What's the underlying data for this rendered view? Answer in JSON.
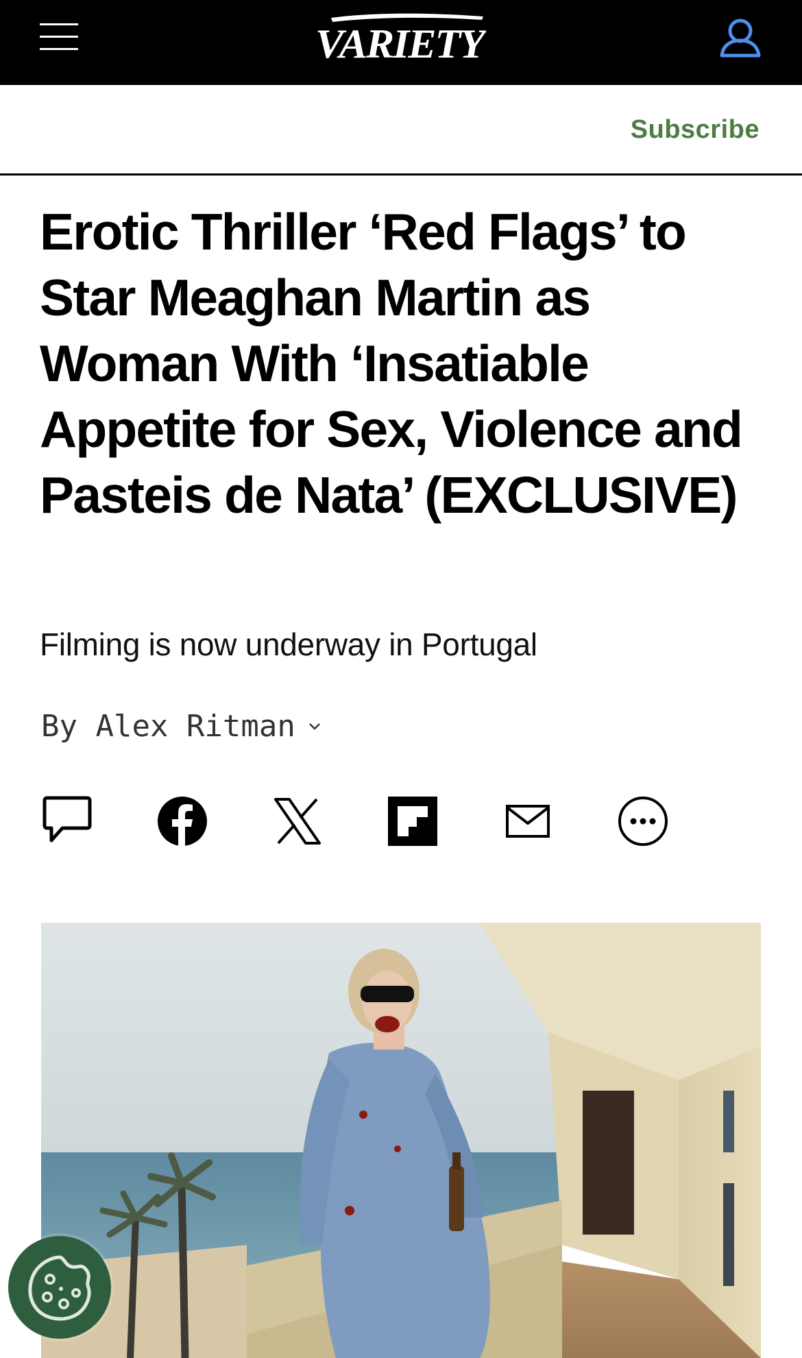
{
  "header": {
    "logo_text": "VARIETY",
    "menu_icon": "hamburger-menu-icon",
    "account_icon": "user-account-icon",
    "accent_color": "#3b82f6"
  },
  "subheader": {
    "subscribe_label": "Subscribe",
    "subscribe_color": "#4d7c43"
  },
  "article": {
    "headline": "Erotic Thriller ‘Red Flags’ to Star Meaghan Martin as Woman With ‘Insatiable Appetite for Sex, Violence and Pasteis de Nata’ (EXCLUSIVE)",
    "dek": "Filming is now underway in Portugal",
    "byline": "By Alex Ritman"
  },
  "share": [
    {
      "icon": "comment-icon"
    },
    {
      "icon": "facebook-icon"
    },
    {
      "icon": "x-icon"
    },
    {
      "icon": "flipboard-icon"
    },
    {
      "icon": "email-icon"
    },
    {
      "icon": "more-options-icon"
    }
  ],
  "cookie_button": {
    "icon": "cookie-icon",
    "color": "#2f5e3f"
  }
}
